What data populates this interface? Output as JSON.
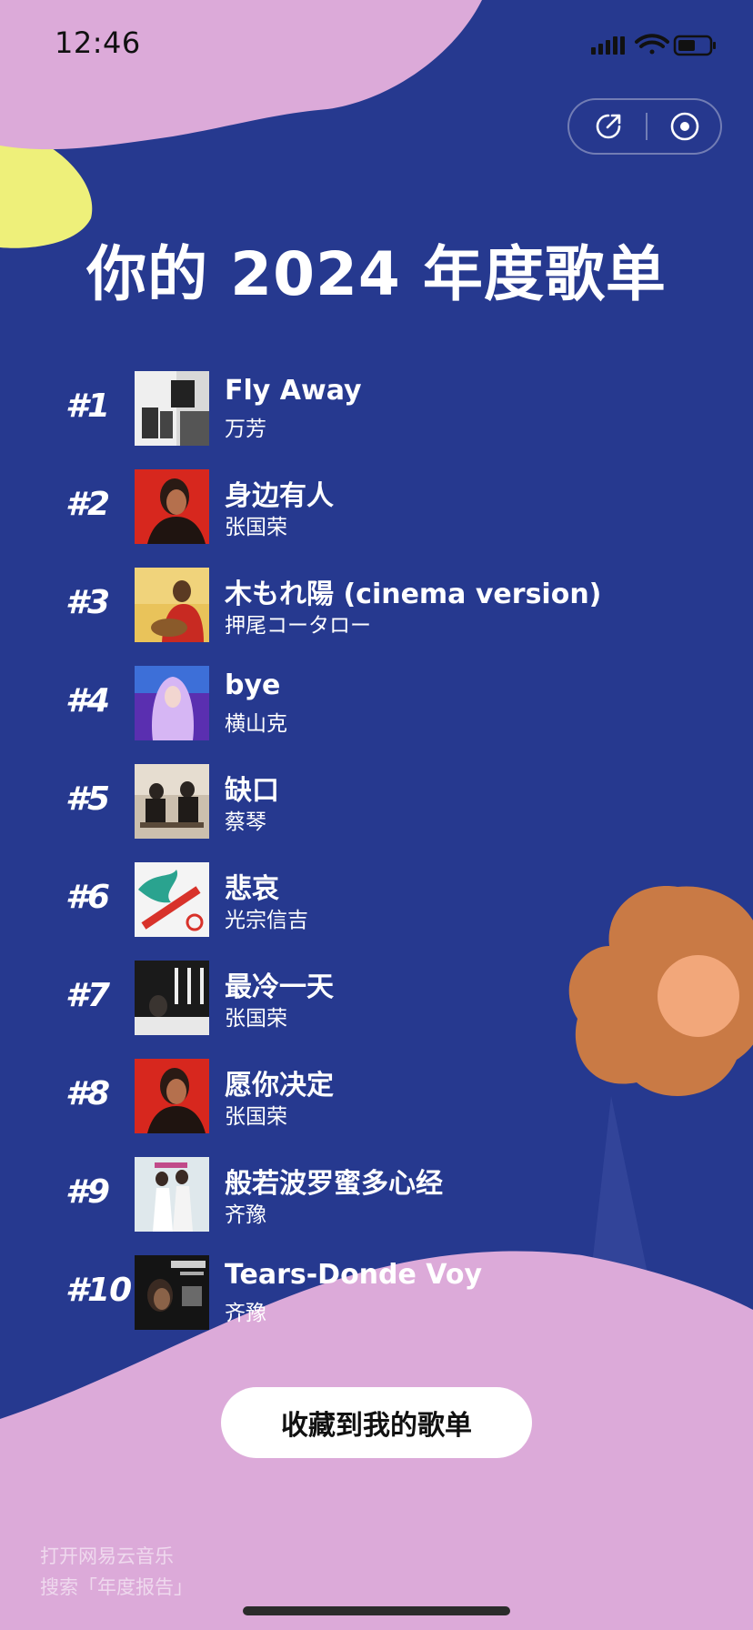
{
  "status_bar": {
    "time": "12:46"
  },
  "title": "你的 2024 年度歌单",
  "songs": [
    {
      "rank": "#1",
      "title": "Fly Away",
      "artist": "万芳"
    },
    {
      "rank": "#2",
      "title": "身边有人",
      "artist": "张国荣"
    },
    {
      "rank": "#3",
      "title": "木もれ陽 (cinema version)",
      "artist": "押尾コータロー"
    },
    {
      "rank": "#4",
      "title": "bye",
      "artist": "横山克"
    },
    {
      "rank": "#5",
      "title": "缺口",
      "artist": "蔡琴"
    },
    {
      "rank": "#6",
      "title": "悲哀",
      "artist": "光宗信吉"
    },
    {
      "rank": "#7",
      "title": "最冷一天",
      "artist": "张国荣"
    },
    {
      "rank": "#8",
      "title": "愿你决定",
      "artist": "张国荣"
    },
    {
      "rank": "#9",
      "title": "般若波罗蜜多心经",
      "artist": "齐豫"
    },
    {
      "rank": "#10",
      "title": "Tears-Donde Voy",
      "artist": "齐豫"
    }
  ],
  "collect_button": "收藏到我的歌单",
  "footer": {
    "line1": "打开网易云音乐",
    "line2": "搜索「年度报告」"
  },
  "colors": {
    "background": "#26398f",
    "pink": "#dcaad9",
    "yellow": "#eef07a",
    "flower": "#c97a45",
    "flower_center": "#f2a77a"
  }
}
